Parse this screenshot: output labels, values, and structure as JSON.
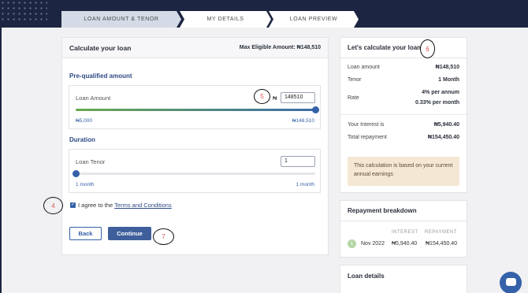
{
  "steps": [
    {
      "label": "LOAN AMOUNT & TENOR"
    },
    {
      "label": "MY DETAILS"
    },
    {
      "label": "LOAN PREVIEW"
    }
  ],
  "calculator": {
    "title": "Calculate your loan",
    "max_eligible": "Max Eligible Amount: ₦148,510",
    "prequalified_title": "Pre-qualified amount",
    "amount_label": "Loan Amount",
    "currency": "₦",
    "amount_value": "148510",
    "amount_min": "₦5,000",
    "amount_max": "₦148,510",
    "amount_fraction": 1.0,
    "duration_title": "Duration",
    "tenor_label": "Loan Tenor",
    "tenor_value": "1",
    "tenor_min": "1 month",
    "tenor_max": "1 month",
    "tenor_fraction": 0.0,
    "agree_text": "I agree to the ",
    "terms_link": "Terms and Conditions",
    "back_label": "Back",
    "continue_label": "Continue"
  },
  "annotations": {
    "a4": "4",
    "a5": "5",
    "a6": "6",
    "a7": "7"
  },
  "summary": {
    "title": "Let's calculate your loan",
    "loan_amount_label": "Loan amount",
    "loan_amount_value": "₦148,510",
    "tenor_label": "Tenor",
    "tenor_value": "1 Month",
    "rate_label": "Rate",
    "rate_annum": "4% per annum",
    "rate_month": "0.33% per month",
    "interest_label": "Your Interest is",
    "interest_value": "₦5,940.40",
    "repayment_label": "Total repayment",
    "repayment_value": "₦154,450.40",
    "note": "This calculation is based on your current annual earnings"
  },
  "repayment": {
    "title": "Repayment breakdown",
    "col_interest": "INTEREST",
    "col_repayment": "REPAYMENT",
    "rows": [
      {
        "num": "1",
        "date": "Nov 2022",
        "interest": "₦5,940.40",
        "repayment": "₦154,450.40"
      }
    ]
  },
  "details": {
    "title": "Loan details"
  },
  "colors": {
    "primary": "#3461a8",
    "navy": "#1c2541",
    "note_bg": "#f4e8d4"
  }
}
